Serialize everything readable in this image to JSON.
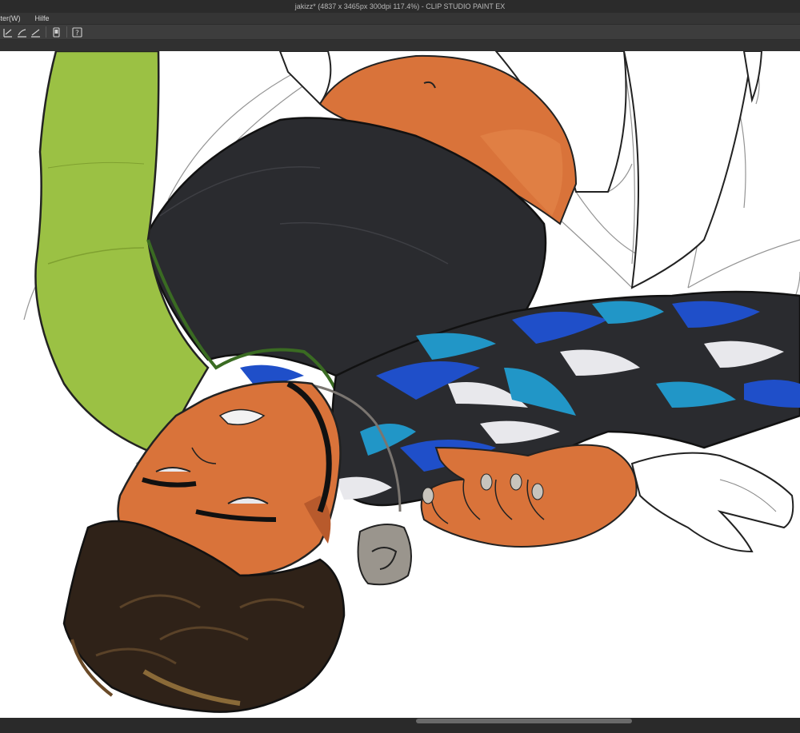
{
  "window": {
    "title": "jakizz* (4837 x 3465px 300dpi 117.4%)  - CLIP STUDIO PAINT EX"
  },
  "menu": {
    "items": [
      {
        "label": "ster(W)"
      },
      {
        "label": "Hilfe"
      }
    ]
  },
  "toolbar": {
    "icons": [
      "pen-correct-icon",
      "stabilize-icon",
      "taper-icon",
      "smartphone-icon",
      "help-icon"
    ]
  },
  "colors": {
    "skin": "#d9733a",
    "skin_shadow": "#b85a2c",
    "sleeve_green": "#9bc144",
    "shirt_dark": "#2a2b2f",
    "pattern_blue": "#1f4fc9",
    "pattern_cyan": "#2196c7",
    "hair": "#2f2218",
    "pendant": "#9a958d"
  }
}
